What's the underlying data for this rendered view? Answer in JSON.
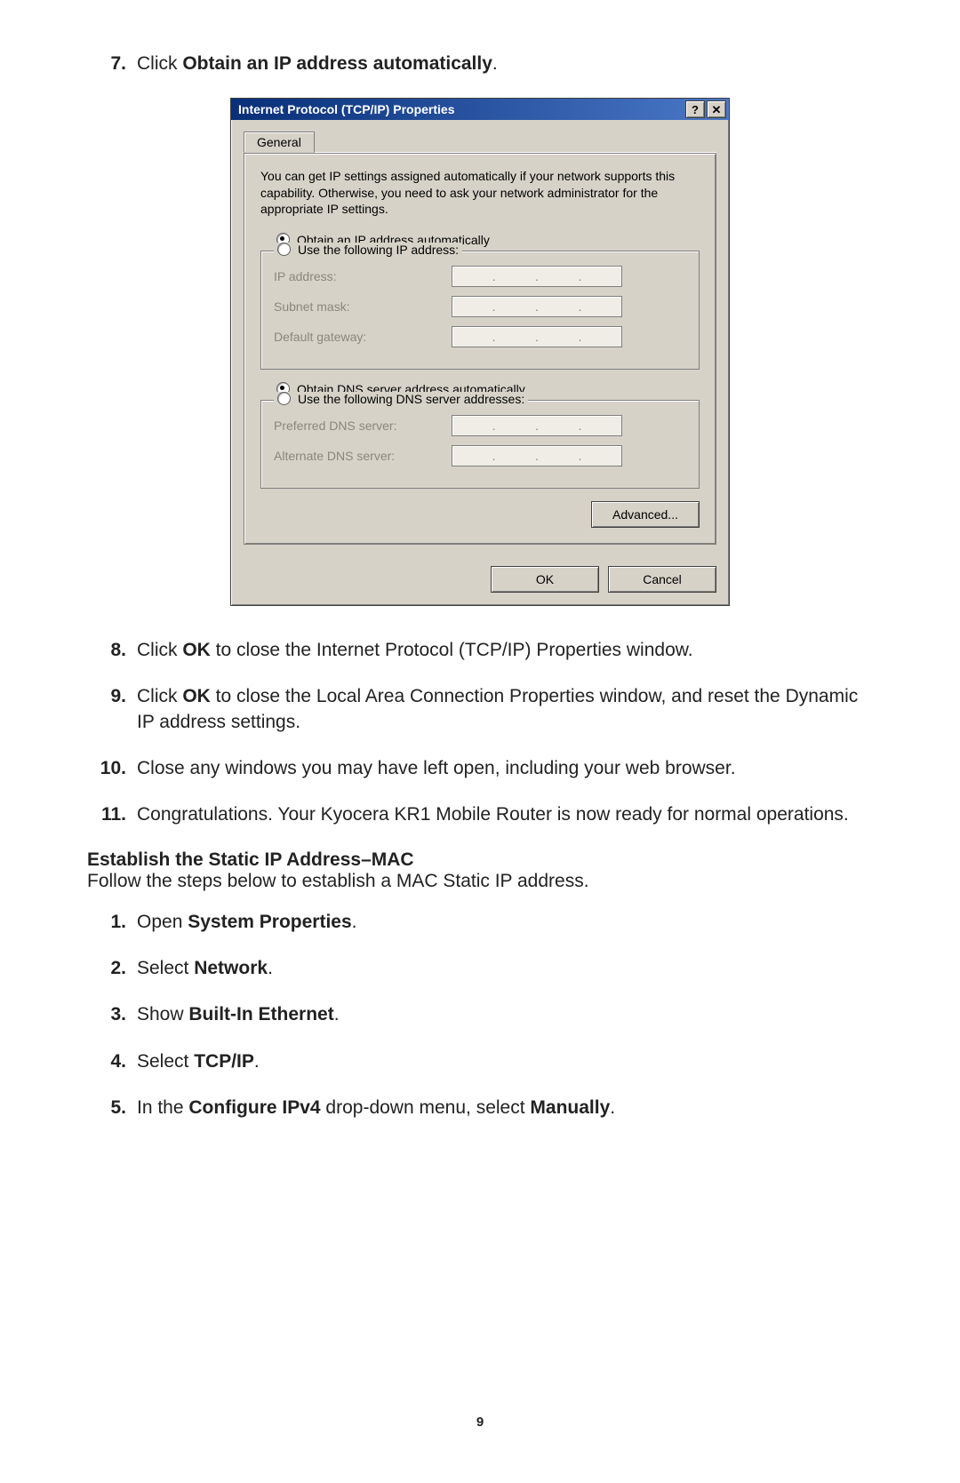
{
  "page_number": "9",
  "instructions_top": [
    {
      "num": "7.",
      "prefix": "Click ",
      "bold": "Obtain an IP address automatically",
      "suffix": "."
    }
  ],
  "instructions_mid": [
    {
      "num": "8.",
      "prefix": "Click ",
      "bold": "OK",
      "suffix": " to close the Internet Protocol (TCP/IP) Properties window."
    },
    {
      "num": "9.",
      "prefix": "Click ",
      "bold": "OK",
      "suffix": " to close the Local Area Connection Properties window, and reset the Dynamic IP address settings."
    },
    {
      "num": "10.",
      "prefix": "",
      "bold": "",
      "suffix": "Close any windows you may have left open, including your web browser."
    },
    {
      "num": "11.",
      "prefix": "",
      "bold": "",
      "suffix": "Congratulations. Your Kyocera KR1 Mobile Router is now ready for normal operations."
    }
  ],
  "mac_section": {
    "heading": "Establish the Static IP Address–MAC",
    "subtitle": "Follow the steps below to establish a MAC Static IP address."
  },
  "instructions_mac": [
    {
      "num": "1.",
      "prefix": "Open ",
      "bold": "System Properties",
      "suffix": "."
    },
    {
      "num": "2.",
      "prefix": "Select ",
      "bold": "Network",
      "suffix": "."
    },
    {
      "num": "3.",
      "prefix": "Show ",
      "bold": "Built-In Ethernet",
      "suffix": "."
    },
    {
      "num": "4.",
      "prefix": "Select ",
      "bold": "TCP/IP",
      "suffix": "."
    },
    {
      "num": "5.",
      "prefix": "In the ",
      "bold": "Configure IPv4",
      "suffix": " drop-down menu, select ",
      "bold2": "Manually",
      "suffix2": "."
    }
  ],
  "dialog": {
    "title": "Internet Protocol (TCP/IP) Properties",
    "help_glyph": "?",
    "close_glyph": "✕",
    "tab_general": "General",
    "intro": "You can get IP settings assigned automatically if your network supports this capability. Otherwise, you need to ask your network administrator for the appropriate IP settings.",
    "radio_ip_auto": "Obtain an IP address automatically",
    "radio_ip_manual_legend": "Use the following IP address:",
    "fields_ip": {
      "ip_address": "IP address:",
      "subnet_mask": "Subnet mask:",
      "default_gateway": "Default gateway:"
    },
    "radio_dns_auto": "Obtain DNS server address automatically",
    "radio_dns_manual_legend": "Use the following DNS server addresses:",
    "fields_dns": {
      "preferred": "Preferred DNS server:",
      "alternate": "Alternate DNS server:"
    },
    "advanced": "Advanced...",
    "ok": "OK",
    "cancel": "Cancel"
  }
}
